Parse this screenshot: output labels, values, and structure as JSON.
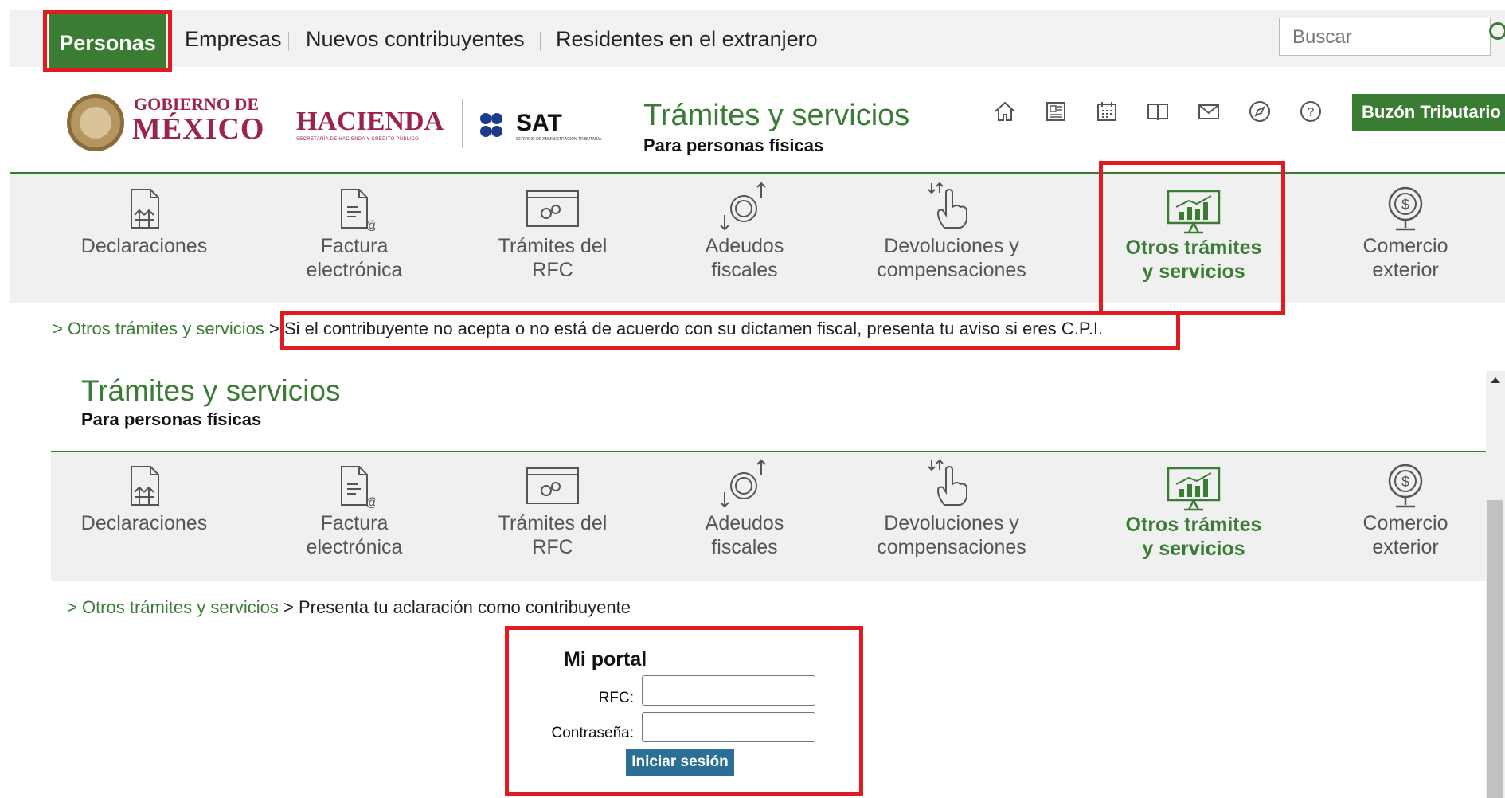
{
  "topnav": {
    "active": "Personas",
    "items": [
      "Empresas",
      "Nuevos contribuyentes",
      "Residentes en el extranjero"
    ],
    "search_placeholder": "Buscar"
  },
  "brand": {
    "gob_de": "GOBIERNO DE",
    "gob_mexico": "MÉXICO",
    "hacienda": "HACIENDA",
    "hacienda_sub": "SECRETARÍA DE HACIENDA Y CRÉDITO PÚBLICO",
    "sat": "SAT",
    "sat_sub": "SERVICIO DE ADMINISTRACIÓN TRIBUTARIA"
  },
  "header": {
    "title": "Trámites y servicios",
    "subtitle": "Para personas físicas",
    "icons": [
      "home-icon",
      "news-icon",
      "calendar-icon",
      "book-icon",
      "mail-icon",
      "compass-icon",
      "help-icon"
    ],
    "buzon": "Buzón Tributario"
  },
  "categories": [
    {
      "line1": "Declaraciones",
      "line2": "",
      "icon": "declaraciones-icon"
    },
    {
      "line1": "Factura",
      "line2": "electrónica",
      "icon": "factura-icon"
    },
    {
      "line1": "Trámites del",
      "line2": "RFC",
      "icon": "rfc-icon"
    },
    {
      "line1": "Adeudos",
      "line2": "fiscales",
      "icon": "adeudos-icon"
    },
    {
      "line1": "Devoluciones y",
      "line2": "compensaciones",
      "icon": "devoluciones-icon"
    },
    {
      "line1": "Otros trámites",
      "line2": "y servicios",
      "icon": "otros-tramites-icon",
      "active": true
    },
    {
      "line1": "Comercio",
      "line2": "exterior",
      "icon": "comercio-icon"
    }
  ],
  "breadcrumb1": {
    "link": "> Otros trámites y servicios",
    "current": "> Si el contribuyente no acepta o no está de acuerdo con su dictamen fiscal, presenta tu aviso si eres C.P.I."
  },
  "section2": {
    "title": "Trámites y servicios",
    "subtitle": "Para personas físicas"
  },
  "breadcrumb2": {
    "link": "> Otros trámites y servicios",
    "current": "> Presenta tu aclaración como contribuyente"
  },
  "login": {
    "title": "Mi portal",
    "rfc_label": "RFC:",
    "rfc_value": "",
    "password_label": "Contraseña:",
    "password_value": "",
    "submit": "Iniciar sesión"
  },
  "colors": {
    "brand_green": "#3b7c35",
    "gob_maroon": "#9d2449",
    "highlight_red": "#e21b23",
    "login_button": "#2b6f94"
  }
}
